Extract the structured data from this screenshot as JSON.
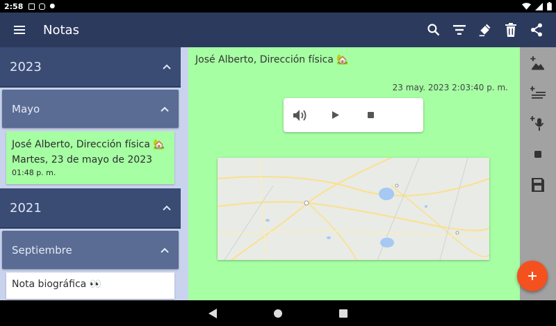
{
  "status_bar": {
    "time": "2:58"
  },
  "app_bar": {
    "title": "Notas"
  },
  "sidebar": {
    "groups": [
      {
        "year": "2023",
        "month": "Mayo",
        "note": {
          "title": "José Alberto, Dirección física 🏡",
          "date": "Martes, 23 de mayo de 2023",
          "time": "01:48 p. m."
        }
      },
      {
        "year": "2021",
        "month": "Septiembre",
        "note": {
          "title": "Nota biográfica 👀"
        }
      }
    ]
  },
  "note": {
    "title": "José Alberto, Dirección física 🏡",
    "datetime": "23 may. 2023 2:03:40 p. m.",
    "background": "#a6ffa3"
  },
  "colors": {
    "app_bar": "#2c3a5e",
    "year_header": "#3a4b74",
    "month_header": "#5a6c94",
    "fab": "#f4511e"
  },
  "icons": {
    "app_bar": [
      "menu-icon",
      "search-icon",
      "filter-icon",
      "color-fill-icon",
      "delete-icon",
      "share-icon"
    ],
    "toolbar": [
      "add-image-icon",
      "add-text-icon",
      "add-voice-icon",
      "stop-icon",
      "save-icon"
    ],
    "audio": [
      "volume-icon",
      "play-icon",
      "stop-icon"
    ],
    "fab": "add-icon"
  }
}
